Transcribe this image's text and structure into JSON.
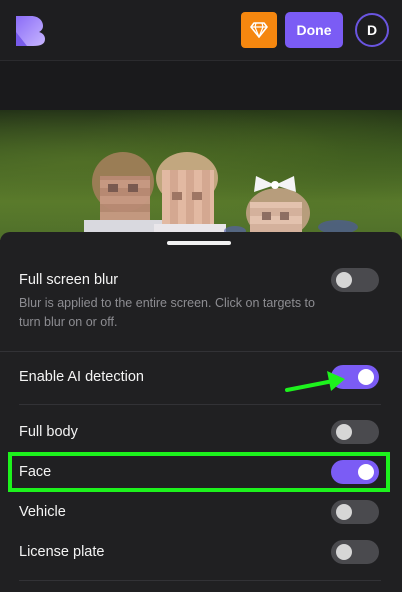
{
  "header": {
    "logo_icon": "app-logo-icon",
    "premium_icon": "diamond-icon",
    "done_label": "Done",
    "avatar_initial": "D",
    "colors": {
      "accent": "#7b5cf5",
      "premium": "#f5870f"
    }
  },
  "photo": {
    "description_icon": "blurred-children-photo"
  },
  "settings": {
    "full_screen_blur": {
      "label": "Full screen blur",
      "description": "Blur is applied to the entire screen. Click on targets to turn blur on or off.",
      "enabled": false
    },
    "ai_detection": {
      "label": "Enable AI detection",
      "enabled": true
    },
    "targets": [
      {
        "label": "Full body",
        "enabled": false
      },
      {
        "label": "Face",
        "enabled": true
      },
      {
        "label": "Vehicle",
        "enabled": false
      },
      {
        "label": "License plate",
        "enabled": false
      }
    ]
  },
  "annotations": {
    "highlight_color": "#1df21d",
    "arrow_icon": "green-arrow-icon"
  }
}
